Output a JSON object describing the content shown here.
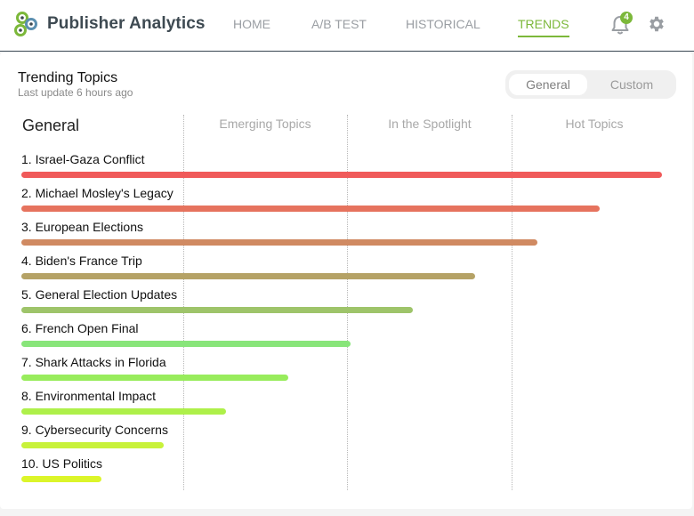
{
  "app": {
    "name": "Publisher Analytics"
  },
  "nav": [
    {
      "label": "HOME"
    },
    {
      "label": "A/B TEST"
    },
    {
      "label": "HISTORICAL"
    },
    {
      "label": "TRENDS",
      "active": true
    }
  ],
  "notifications": {
    "count": "4"
  },
  "panel": {
    "title": "Trending Topics",
    "subtitle": "Last update 6 hours ago",
    "toggle": {
      "selected": "General",
      "options": [
        "General",
        "Custom"
      ]
    },
    "columns": {
      "general": "General",
      "emerging": "Emerging Topics",
      "spotlight": "In the Spotlight",
      "hot": "Hot Topics"
    }
  },
  "topics": [
    {
      "label": "1. Israel-Gaza Conflict",
      "score": 1.0,
      "color": "#f05a5a"
    },
    {
      "label": "2. Michael Mosley's Legacy",
      "score": 0.903,
      "color": "#e6735e"
    },
    {
      "label": "3. European Elections",
      "score": 0.806,
      "color": "#d08a62"
    },
    {
      "label": "4. Biden's France Trip",
      "score": 0.708,
      "color": "#b5a266"
    },
    {
      "label": "5. General Election Updates",
      "score": 0.611,
      "color": "#9ec46a"
    },
    {
      "label": "6. French Open Final",
      "score": 0.514,
      "color": "#88e57a"
    },
    {
      "label": "7. Shark Attacks in Florida",
      "score": 0.417,
      "color": "#98ec5c"
    },
    {
      "label": "8. Environmental Impact",
      "score": 0.319,
      "color": "#aef04a"
    },
    {
      "label": "9. Cybersecurity Concerns",
      "score": 0.222,
      "color": "#c8f23a"
    },
    {
      "label": "10. US Politics",
      "score": 0.125,
      "color": "#dcf52a"
    }
  ],
  "colors": {
    "accent": "#7cb83a",
    "header_border": "#3c4a56"
  }
}
